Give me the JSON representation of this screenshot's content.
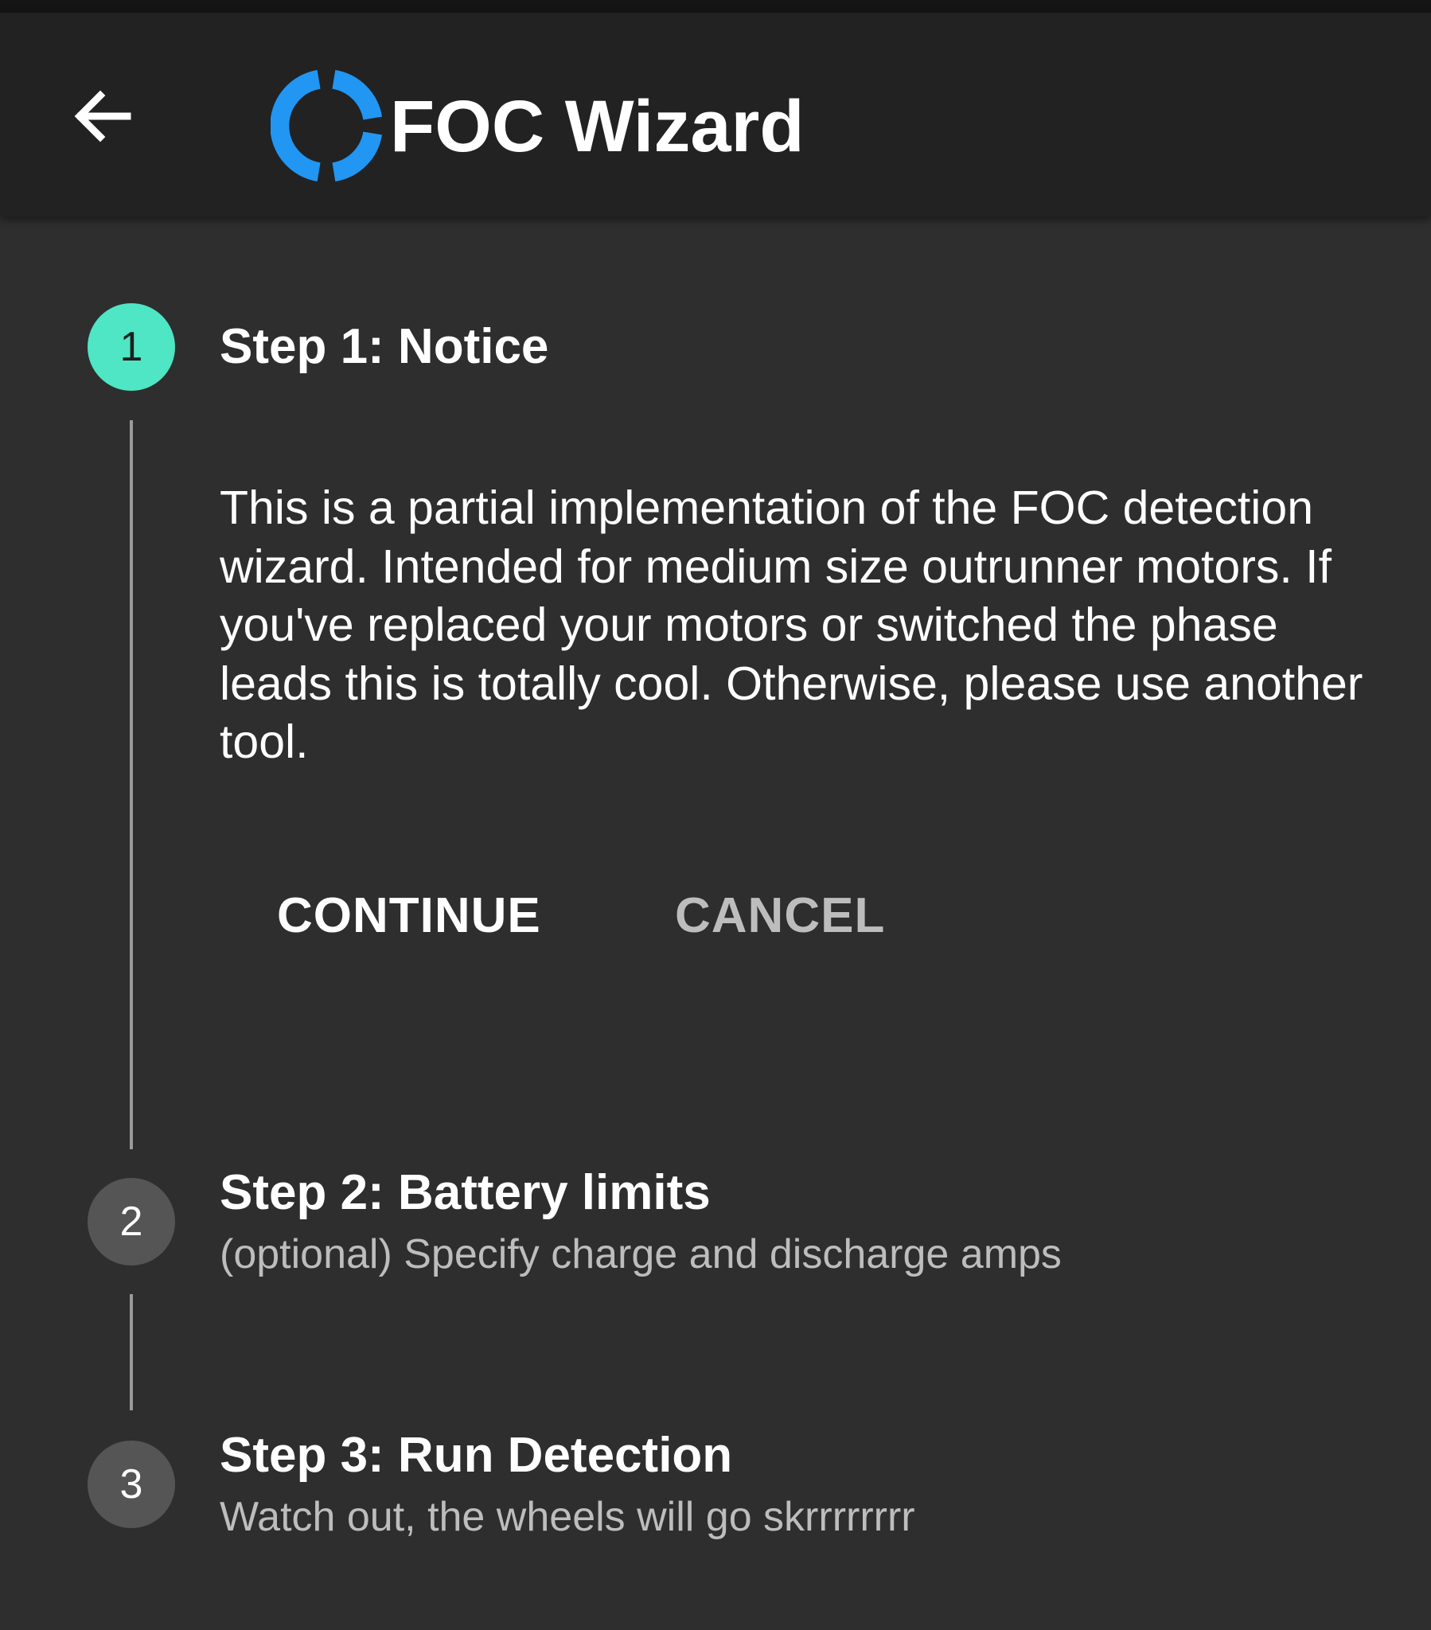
{
  "app_bar": {
    "title": "FOC Wizard",
    "back_icon": "arrow-left-icon",
    "logo_icon": "ring-logo-icon",
    "logo_color": "#2196f3"
  },
  "steps": [
    {
      "number": "1",
      "title": "Step 1: Notice",
      "state": "active",
      "body": "This is a partial implementation of the FOC detection wizard. Intended for medium size outrunner motors. If you've replaced your motors or switched the phase leads this is totally cool. Otherwise, please use another tool.",
      "actions": {
        "continue_label": "CONTINUE",
        "cancel_label": "CANCEL"
      }
    },
    {
      "number": "2",
      "title": "Step 2: Battery limits",
      "subtitle": "(optional) Specify charge and discharge amps",
      "state": "inactive"
    },
    {
      "number": "3",
      "title": "Step 3: Run Detection",
      "subtitle": "Watch out, the wheels will go skrrrrrrrr",
      "state": "inactive"
    }
  ],
  "colors": {
    "background": "#2e2e2e",
    "app_bar": "#222222",
    "active_step": "#4ee6c4",
    "inactive_step": "#555555",
    "accent": "#2196f3"
  }
}
